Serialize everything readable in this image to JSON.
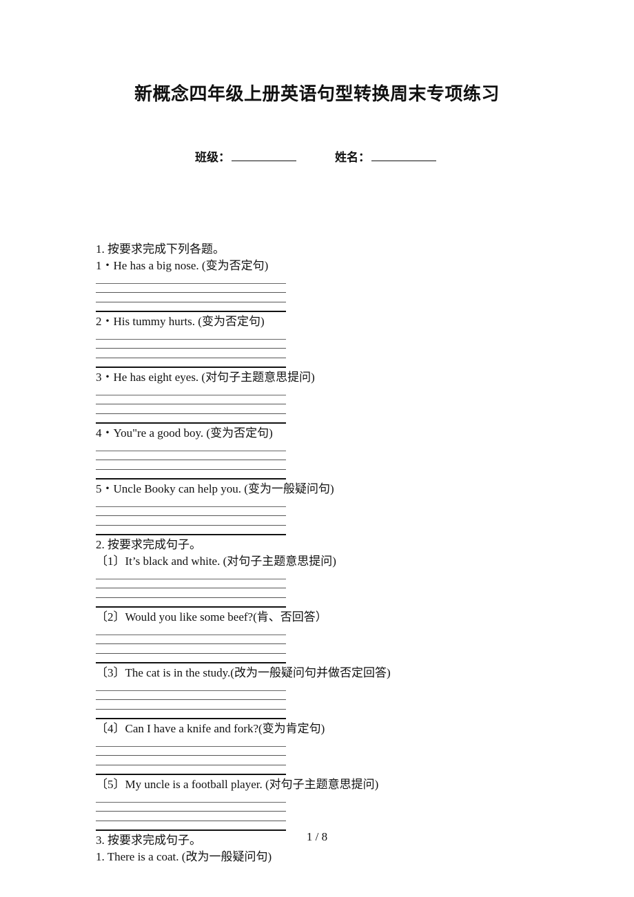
{
  "title": "新概念四年级上册英语句型转换周末专项练习",
  "info": {
    "class_label": "班级：",
    "name_label": "姓名："
  },
  "sections": [
    {
      "heading": "1. 按要求完成下列各题。",
      "items": [
        "1・He has a big nose. (变为否定句)",
        "2・His tummy hurts. (变为否定句)",
        "3・He has eight eyes. (对句子主题意思提问)",
        "4・You\"re a good boy. (变为否定句)",
        "5・Uncle Booky can help you. (变为一般疑问句)"
      ]
    },
    {
      "heading": "2. 按要求完成句子。",
      "items": [
        "〔1〕It’s black and white. (对句子主题意思提问)",
        "〔2〕Would you like some beef?(肯、否回答）",
        "〔3〕The cat is in the study.(改为一般疑问句并做否定回答)",
        "〔4〕Can I have a knife and fork?(变为肯定句)",
        "〔5〕My uncle is a football player. (对句子主题意思提问)"
      ]
    },
    {
      "heading": "3. 按要求完成句子。",
      "items": [
        "1. There is a coat. (改为一般疑问句)"
      ]
    }
  ],
  "page_number": "1 / 8"
}
